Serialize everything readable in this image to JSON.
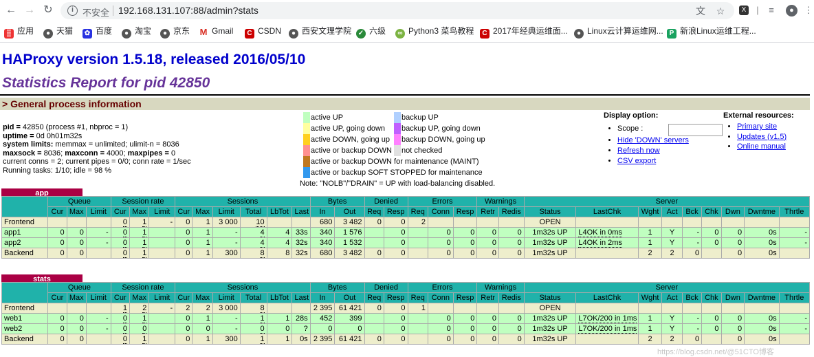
{
  "browser": {
    "insecure_label": "不安全",
    "url": "192.168.131.107:88/admin?stats",
    "bookmarks": [
      "应用",
      "天猫",
      "百度",
      "淘宝",
      "京东",
      "Gmail",
      "CSDN",
      "西安文理学院",
      "六级",
      "Python3 菜鸟教程",
      "2017年经典运维面...",
      "Linux云计算运维网...",
      "新浪Linux运维工程..."
    ]
  },
  "page": {
    "title": "HAProxy version 1.5.18, released 2016/05/10",
    "subtitle": "Statistics Report for pid 42850",
    "section": "> General process information",
    "info": {
      "pid_label": "pid = ",
      "pid_value": "42850 (process #1, nbproc = 1)",
      "uptime_label": "uptime = ",
      "uptime_value": "0d 0h01m32s",
      "syslim_label": "system limits:",
      "syslim_value": " memmax = unlimited; ulimit-n = 8036",
      "maxsock_label": "maxsock = ",
      "maxsock_value": "8036; ",
      "maxconn_label": "maxconn = ",
      "maxconn_value": "4000; ",
      "maxpipes_label": "maxpipes = ",
      "maxpipes_value": "0",
      "conns": "current conns = 2; current pipes = 0/0; conn rate = 1/sec",
      "tasks": "Running tasks: 1/10; idle = 98 %"
    },
    "legend": [
      {
        "label": "active UP",
        "color": "#c0ffc0"
      },
      {
        "label": "active UP, going down",
        "color": "#ffffa0"
      },
      {
        "label": "active DOWN, going up",
        "color": "#ffd020"
      },
      {
        "label": "active or backup DOWN",
        "color": "#ff9090"
      },
      {
        "label": "active or backup DOWN for maintenance (MAINT)",
        "color": "#c07820"
      },
      {
        "label": "active or backup SOFT STOPPED for maintenance",
        "color": "#3399ee"
      },
      {
        "label": "backup UP",
        "color": "#b0d0ff"
      },
      {
        "label": "backup UP, going down",
        "color": "#c060ff"
      },
      {
        "label": "backup DOWN, going up",
        "color": "#ff80ff"
      },
      {
        "label": "not checked",
        "color": "#e0e0e0"
      }
    ],
    "legend_note": "Note: \"NOLB\"/\"DRAIN\" = UP with load-balancing disabled.",
    "display": {
      "title": "Display option:",
      "scope_label": "Scope :",
      "links": [
        "Hide 'DOWN' servers",
        "Refresh now",
        "CSV export"
      ]
    },
    "external": {
      "title": "External resources:",
      "links": [
        "Primary site",
        "Updates (v1.5)",
        "Online manual"
      ]
    },
    "watermark": "https://blog.csdn.net/@51CTO博客"
  },
  "headers": {
    "groups": [
      "Queue",
      "Session rate",
      "Sessions",
      "Bytes",
      "Denied",
      "Errors",
      "Warnings",
      "Server"
    ],
    "cols": [
      "Cur",
      "Max",
      "Limit",
      "Cur",
      "Max",
      "Limit",
      "Cur",
      "Max",
      "Limit",
      "Total",
      "LbTot",
      "Last",
      "In",
      "Out",
      "Req",
      "Resp",
      "Req",
      "Conn",
      "Resp",
      "Retr",
      "Redis",
      "Status",
      "LastChk",
      "Wght",
      "Act",
      "Bck",
      "Chk",
      "Dwn",
      "Dwntme",
      "Thrtle"
    ]
  },
  "proxies": [
    {
      "name": "app",
      "rows": [
        {
          "type": "fe",
          "cells": [
            "Frontend",
            "",
            "",
            "",
            "0",
            "1",
            "-",
            "0",
            "1",
            "3 000",
            "10",
            "",
            "",
            "680",
            "3 482",
            "0",
            "0",
            "2",
            "",
            "",
            "",
            "",
            "",
            "OPEN",
            "",
            "",
            "",
            "",
            "",
            "",
            "",
            ""
          ]
        },
        {
          "type": "up",
          "cells": [
            "app1",
            "0",
            "0",
            "-",
            "0",
            "1",
            "",
            "0",
            "1",
            "-",
            "4",
            "4",
            "33s",
            "340",
            "1 576",
            "",
            "0",
            "",
            "0",
            "0",
            "0",
            "0",
            "1m32s UP",
            "L4OK in 0ms",
            "1",
            "Y",
            "-",
            "0",
            "0",
            "0s",
            "-"
          ]
        },
        {
          "type": "up",
          "cells": [
            "app2",
            "0",
            "0",
            "-",
            "0",
            "1",
            "",
            "0",
            "1",
            "-",
            "4",
            "4",
            "32s",
            "340",
            "1 532",
            "",
            "0",
            "",
            "0",
            "0",
            "0",
            "0",
            "1m32s UP",
            "L4OK in 2ms",
            "1",
            "Y",
            "-",
            "0",
            "0",
            "0s",
            "-"
          ]
        },
        {
          "type": "be",
          "cells": [
            "Backend",
            "0",
            "0",
            "",
            "0",
            "1",
            "",
            "0",
            "1",
            "300",
            "8",
            "8",
            "32s",
            "680",
            "3 482",
            "0",
            "0",
            "",
            "0",
            "0",
            "0",
            "0",
            "1m32s UP",
            "",
            "2",
            "2",
            "0",
            "",
            "0",
            "0s",
            ""
          ]
        }
      ]
    },
    {
      "name": "stats",
      "rows": [
        {
          "type": "fe",
          "cells": [
            "Frontend",
            "",
            "",
            "",
            "1",
            "2",
            "-",
            "2",
            "2",
            "3 000",
            "8",
            "",
            "",
            "2 395",
            "61 421",
            "0",
            "0",
            "1",
            "",
            "",
            "",
            "",
            "",
            "OPEN",
            "",
            "",
            "",
            "",
            "",
            "",
            "",
            ""
          ]
        },
        {
          "type": "up",
          "cells": [
            "web1",
            "0",
            "0",
            "-",
            "0",
            "1",
            "",
            "0",
            "1",
            "-",
            "1",
            "1",
            "28s",
            "452",
            "399",
            "",
            "0",
            "",
            "0",
            "0",
            "0",
            "0",
            "1m32s UP",
            "L7OK/200 in 1ms",
            "1",
            "Y",
            "-",
            "0",
            "0",
            "0s",
            "-"
          ]
        },
        {
          "type": "up",
          "cells": [
            "web2",
            "0",
            "0",
            "-",
            "0",
            "0",
            "",
            "0",
            "0",
            "-",
            "0",
            "0",
            "?",
            "0",
            "0",
            "",
            "0",
            "",
            "0",
            "0",
            "0",
            "0",
            "1m32s UP",
            "L7OK/200 in 1ms",
            "1",
            "Y",
            "-",
            "0",
            "0",
            "0s",
            "-"
          ]
        },
        {
          "type": "be",
          "cells": [
            "Backend",
            "0",
            "0",
            "",
            "0",
            "1",
            "",
            "0",
            "1",
            "300",
            "1",
            "1",
            "0s",
            "2 395",
            "61 421",
            "0",
            "0",
            "",
            "0",
            "0",
            "0",
            "0",
            "1m32s UP",
            "",
            "2",
            "2",
            "0",
            "",
            "0",
            "0s",
            ""
          ]
        }
      ]
    }
  ]
}
